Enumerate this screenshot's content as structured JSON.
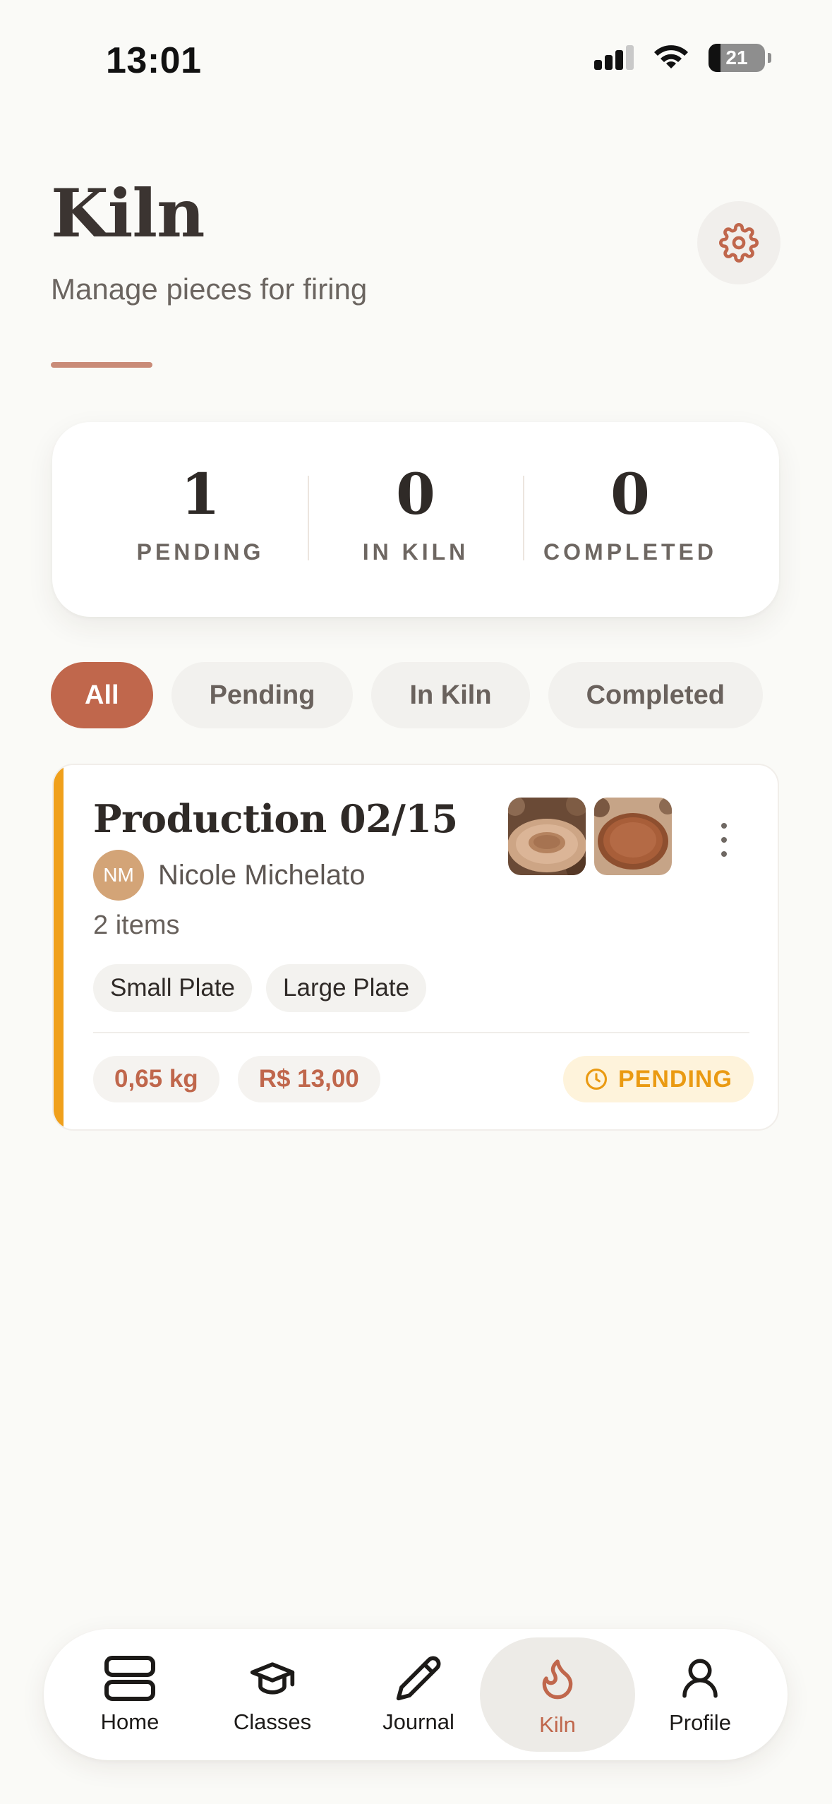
{
  "status_bar": {
    "time": "13:01",
    "battery": "21",
    "battery_level": 0.21
  },
  "header": {
    "title": "Kiln",
    "subtitle": "Manage pieces for firing",
    "settings_icon": "gear-icon"
  },
  "stats": [
    {
      "value": "1",
      "label": "PENDING"
    },
    {
      "value": "0",
      "label": "IN KILN"
    },
    {
      "value": "0",
      "label": "COMPLETED"
    }
  ],
  "filters": [
    {
      "label": "All",
      "active": true
    },
    {
      "label": "Pending",
      "active": false
    },
    {
      "label": "In Kiln",
      "active": false
    },
    {
      "label": "Completed",
      "active": false
    }
  ],
  "card": {
    "title": "Production 02/15",
    "owner_initials": "NM",
    "owner_name": "Nicole Michelato",
    "item_count": "2 items",
    "tags": [
      "Small Plate",
      "Large Plate"
    ],
    "weight": "0,65 kg",
    "price": "R$ 13,00",
    "status": "PENDING",
    "status_color": "#EA9A12",
    "stripe_color": "#F0A01B"
  },
  "nav": {
    "items": [
      {
        "label": "Home",
        "icon": "home-icon"
      },
      {
        "label": "Classes",
        "icon": "graduation-cap-icon"
      },
      {
        "label": "Journal",
        "icon": "pencil-icon"
      },
      {
        "label": "Kiln",
        "icon": "flame-icon",
        "active": true
      },
      {
        "label": "Profile",
        "icon": "user-icon"
      }
    ]
  },
  "colors": {
    "accent": "#C0674C",
    "background": "#FAFAF7",
    "pending": "#F0A01B"
  }
}
